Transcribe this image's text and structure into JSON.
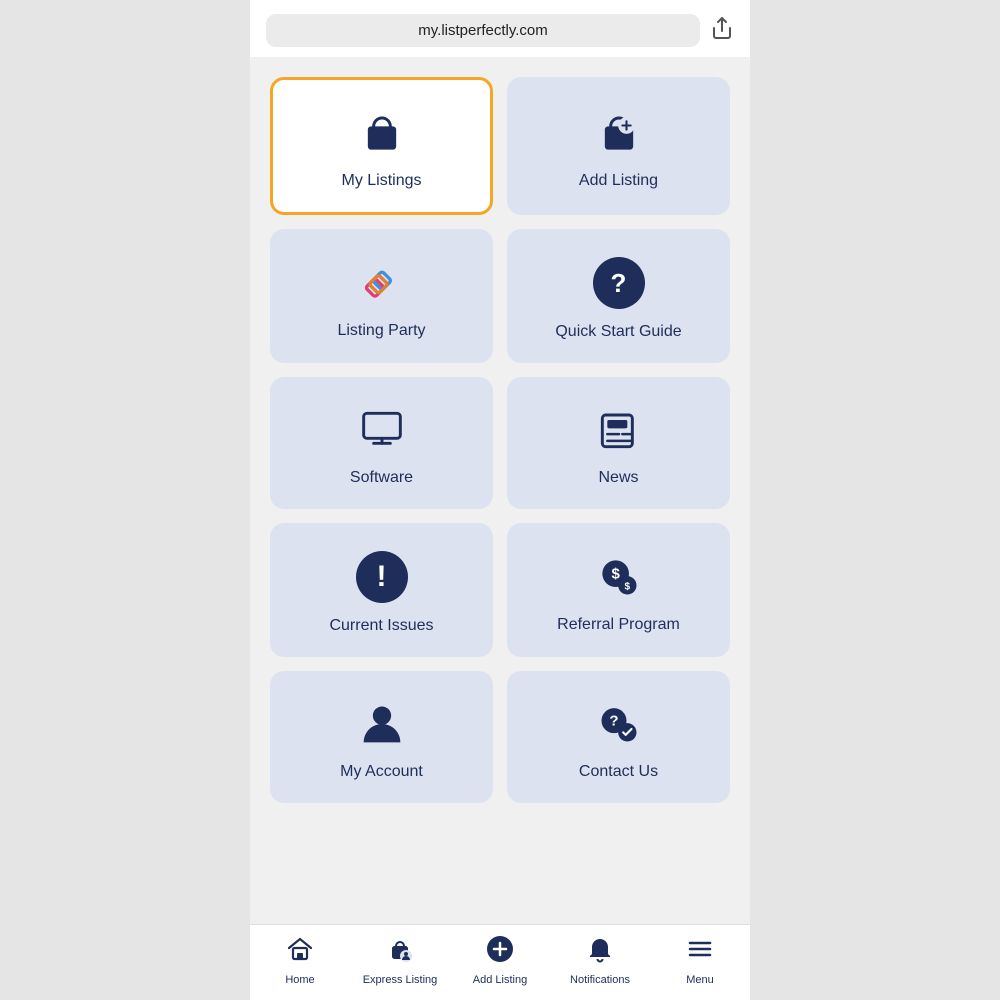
{
  "browser": {
    "url": "my.listperfectly.com",
    "share_icon": "⬆"
  },
  "grid_items": [
    {
      "id": "my-listings",
      "label": "My Listings",
      "icon_type": "bag",
      "selected": true
    },
    {
      "id": "add-listing",
      "label": "Add Listing",
      "icon_type": "bag-plus",
      "selected": false
    },
    {
      "id": "listing-party",
      "label": "Listing Party",
      "icon_type": "diamond",
      "selected": false
    },
    {
      "id": "quick-start-guide",
      "label": "Quick Start Guide",
      "icon_type": "question-circle",
      "selected": false
    },
    {
      "id": "software",
      "label": "Software",
      "icon_type": "monitor",
      "selected": false
    },
    {
      "id": "news",
      "label": "News",
      "icon_type": "newspaper",
      "selected": false
    },
    {
      "id": "current-issues",
      "label": "Current Issues",
      "icon_type": "exclamation-circle",
      "selected": false
    },
    {
      "id": "referral-program",
      "label": "Referral Program",
      "icon_type": "dollar-chat",
      "selected": false
    },
    {
      "id": "my-account",
      "label": "My Account",
      "icon_type": "person",
      "selected": false
    },
    {
      "id": "contact-us",
      "label": "Contact Us",
      "icon_type": "chat-question",
      "selected": false
    }
  ],
  "bottom_nav": [
    {
      "id": "home",
      "label": "Home",
      "icon_type": "home"
    },
    {
      "id": "express-listing",
      "label": "Express Listing",
      "icon_type": "express"
    },
    {
      "id": "add-listing-nav",
      "label": "Add Listing",
      "icon_type": "plus-circle"
    },
    {
      "id": "notifications",
      "label": "Notifications",
      "icon_type": "bell"
    },
    {
      "id": "menu",
      "label": "Menu",
      "icon_type": "menu"
    }
  ]
}
